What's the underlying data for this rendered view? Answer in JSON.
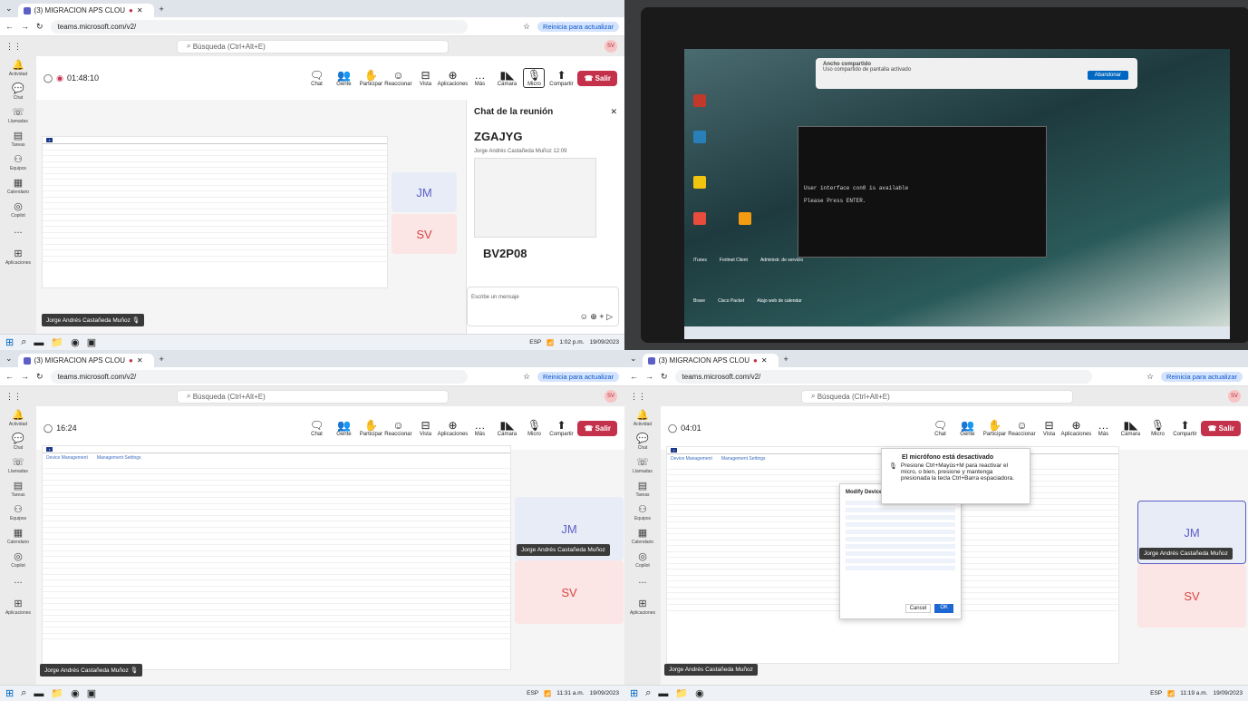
{
  "browser": {
    "tab_title": "(3) MIGRACION APS CLOU",
    "url": "teams.microsoft.com/v2/",
    "reload_label": "Reinicia para actualizar"
  },
  "teams": {
    "search_placeholder": "Búsqueda (Ctrl+Alt+E)",
    "user_initials": "SV",
    "rail": [
      {
        "label": "Actividad",
        "icon": "bell-icon"
      },
      {
        "label": "Chat",
        "icon": "chat-icon"
      },
      {
        "label": "Llamadas",
        "icon": "phone-icon"
      },
      {
        "label": "Tareas",
        "icon": "tasks-icon"
      },
      {
        "label": "Equipos",
        "icon": "teams-icon"
      },
      {
        "label": "Calendario",
        "icon": "calendar-icon"
      },
      {
        "label": "Copilot",
        "icon": "copilot-icon"
      },
      {
        "label": "...",
        "icon": "more-icon"
      },
      {
        "label": "Aplicaciones",
        "icon": "apps-icon"
      }
    ],
    "controls": {
      "chat": "Chat",
      "people": "Gente",
      "people_count": "2",
      "raise": "Participar",
      "react": "Reaccionar",
      "view": "Vista",
      "apps": "Aplicaciones",
      "more": "Más",
      "camera": "Cámara",
      "mic": "Micro",
      "share": "Compartir",
      "leave": "Salir"
    }
  },
  "q1": {
    "timer": "01:48:10",
    "chat_title": "Chat de la reunión",
    "code1": "ZGAJYG",
    "sender": "Jorge Andrés Castañeda Muñoz",
    "sent_time": "12:09",
    "code2": "BV2P08",
    "compose_placeholder": "Escribe un mensaje",
    "presenter": "Jorge Andrés Castañeda Muñoz",
    "tile1": "JM",
    "tile2": "SV",
    "clock_time": "1:02 p.m.",
    "clock_date": "19/09/2023"
  },
  "q2": {
    "notif_title": "Ancho compartido",
    "notif_text": "Uso compartido de pantalla activado",
    "abandon": "Abandonar",
    "term_line1": "User interface con0 is available",
    "term_line2": "Please Press ENTER.",
    "icons": [
      "iTunes",
      "Fortinet Client",
      "Administr. de servicio",
      "Brave",
      "Cisco Packet",
      "Atajo web de calendar"
    ]
  },
  "q3": {
    "timer": "16:24",
    "presenter": "Jorge Andrés Castañeda Muñoz",
    "tile1": "JM",
    "tile2": "SV",
    "clock_time": "11:31 a.m.",
    "clock_date": "19/09/2023",
    "shared_title": "Device Management",
    "shared_tab2": "Management Settings"
  },
  "q4": {
    "timer": "04:01",
    "toast_title": "El micrófono está desactivado",
    "toast_text": "Presione Ctrl+Mayús+M para reactivar el micro, o bien, presione y mantenga presionada la tecla Ctrl+Barra espaciadora.",
    "modal_title": "Modify Device",
    "modal_cancel": "Cancel",
    "modal_ok": "OK",
    "presenter": "Jorge Andrés Castañeda Muñoz",
    "tile1": "JM",
    "tile2": "SV",
    "clock_time": "11:19 a.m.",
    "clock_date": "19/09/2023",
    "shared_title": "Device Management",
    "shared_tab2": "Management Settings"
  },
  "tray": {
    "lang": "ESP",
    "lang2": "ES"
  },
  "colors": {
    "accent": "#5b5fc7",
    "leave": "#c4314b",
    "taskbar": "#eef1f6"
  }
}
